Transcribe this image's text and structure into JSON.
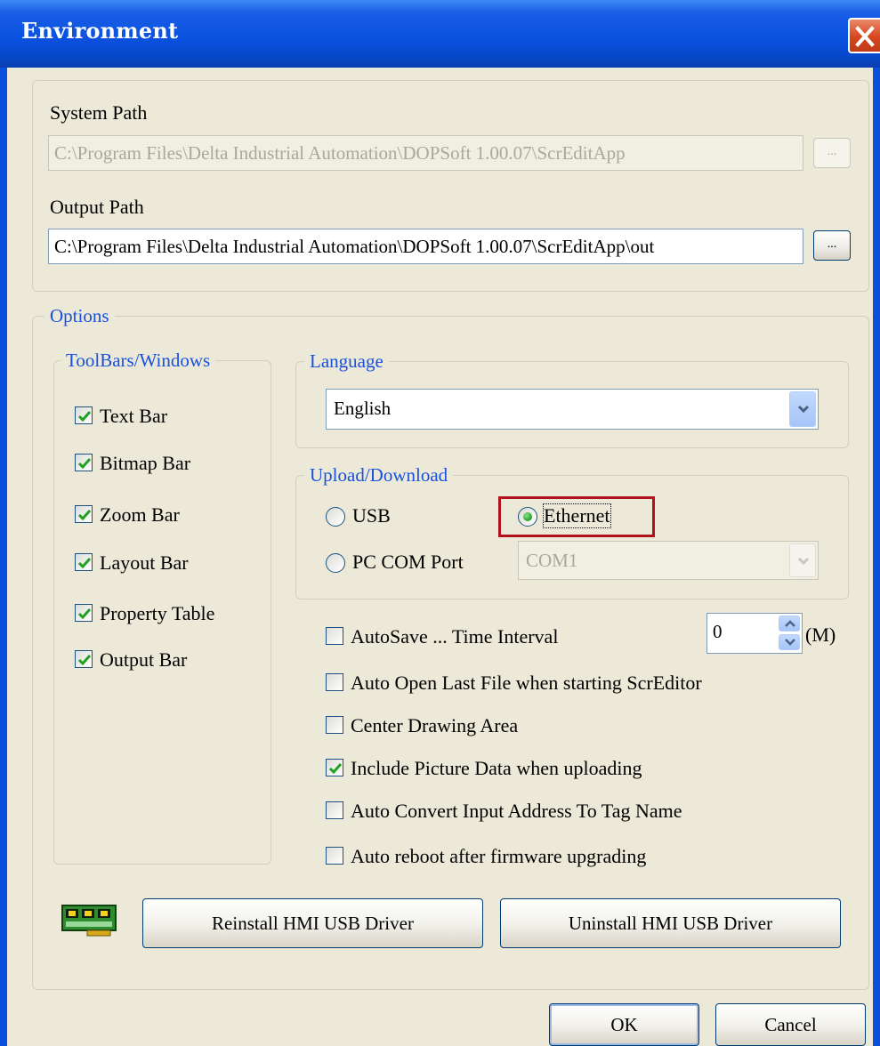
{
  "window": {
    "title": "Environment",
    "close_icon": "close-icon"
  },
  "paths": {
    "system_label": "System Path",
    "system_value": "C:\\Program Files\\Delta Industrial Automation\\DOPSoft 1.00.07\\ScrEditApp",
    "output_label": "Output Path",
    "output_value": "C:\\Program Files\\Delta Industrial Automation\\DOPSoft 1.00.07\\ScrEditApp\\out",
    "browse_label": "..."
  },
  "options": {
    "legend": "Options",
    "toolbars": {
      "legend": "ToolBars/Windows",
      "items": [
        {
          "label": "Text Bar",
          "checked": true
        },
        {
          "label": "Bitmap Bar",
          "checked": true
        },
        {
          "label": "Zoom Bar",
          "checked": true
        },
        {
          "label": "Layout Bar",
          "checked": true
        },
        {
          "label": "Property Table",
          "checked": true
        },
        {
          "label": "Output Bar",
          "checked": true
        }
      ]
    },
    "language": {
      "legend": "Language",
      "selected": "English"
    },
    "upload": {
      "legend": "Upload/Download",
      "usb_label": "USB",
      "ethernet_label": "Ethernet",
      "pc_com_label": "PC COM Port",
      "selected": "Ethernet",
      "com_value": "COM1"
    },
    "autosave": {
      "label": "AutoSave ...  Time Interval",
      "checked": false,
      "interval": "0",
      "unit": "(M)"
    },
    "checks": [
      {
        "label": "Auto Open Last File when starting ScrEditor",
        "checked": false
      },
      {
        "label": "Center Drawing Area",
        "checked": false
      },
      {
        "label": "Include Picture Data when uploading",
        "checked": true
      },
      {
        "label": "Auto Convert Input Address To Tag Name",
        "checked": false
      },
      {
        "label": "Auto reboot after firmware upgrading",
        "checked": false
      }
    ],
    "reinstall_label": "Reinstall HMI USB Driver",
    "uninstall_label": "Uninstall HMI USB Driver"
  },
  "buttons": {
    "ok": "OK",
    "cancel": "Cancel"
  },
  "colors": {
    "title_bar": "#0a52e0",
    "legend_text": "#1850e0",
    "highlight_box": "#b0131e",
    "face": "#ece9d8"
  }
}
